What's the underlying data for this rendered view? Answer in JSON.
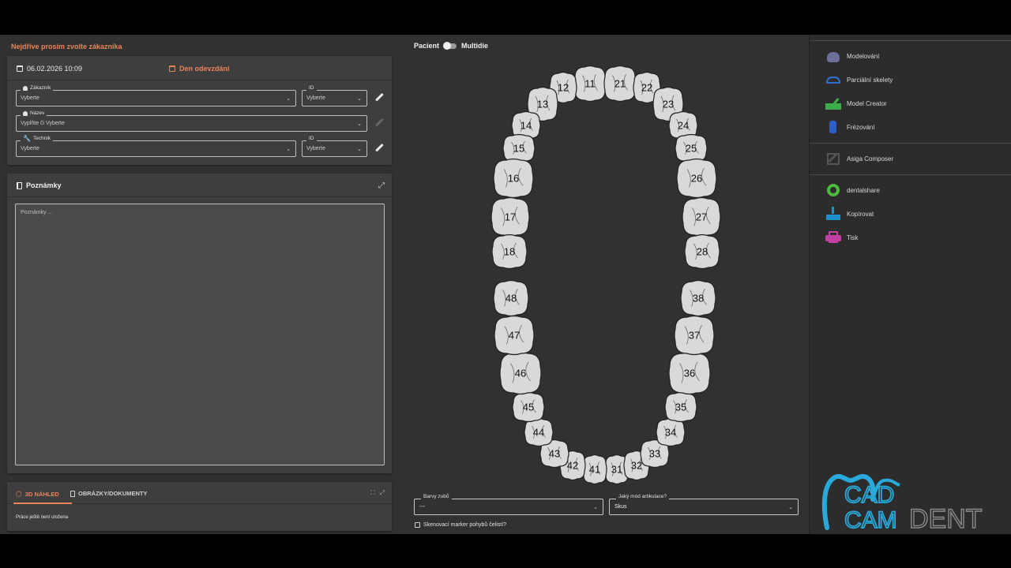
{
  "left": {
    "warning": "Nejdříve prosím zvolte zákazníka",
    "order": {
      "date": "06.02.2026 10:09",
      "deadline": "Den odevzdání",
      "customer": {
        "label": "Zákazník",
        "value": "Vyberte"
      },
      "customer_id": {
        "label": "ID",
        "value": "Vyberte"
      },
      "name": {
        "label": "Název",
        "value": "Vyplňte či Vyberte"
      },
      "technician": {
        "label": "Technik",
        "value": "Vyberte"
      },
      "technician_id": {
        "label": "ID",
        "value": "Vyberte"
      }
    },
    "notes": {
      "title": "Poznámky",
      "placeholder": "Poznámky ..."
    },
    "preview": {
      "tab_3d": "3D NÁHLED",
      "tab_docs": "OBRÁZKY/DOKUMENTY",
      "status": "Práce ještě není uložena"
    }
  },
  "center": {
    "toggle_left": "Pacient",
    "toggle_right": "Multidie",
    "teeth": [
      "11",
      "12",
      "13",
      "14",
      "15",
      "16",
      "17",
      "18",
      "21",
      "22",
      "23",
      "24",
      "25",
      "26",
      "27",
      "28",
      "31",
      "32",
      "33",
      "34",
      "35",
      "36",
      "37",
      "38",
      "41",
      "42",
      "43",
      "44",
      "45",
      "46",
      "47",
      "48"
    ],
    "tooth_colors": {
      "label": "Barvy zubů",
      "value": "---"
    },
    "articulation": {
      "label": "Jaký mód artikulace?",
      "value": "Skus"
    },
    "scan_marker": "Skenovací marker pohybů čelistí?"
  },
  "right": {
    "menu": [
      {
        "label": "Modelování",
        "icon": "modeling-icon",
        "color": "#6d6f99"
      },
      {
        "label": "Parciální skelety",
        "icon": "partial-frameworks-icon",
        "color": "#2f6fd0"
      },
      {
        "label": "Model Creator",
        "icon": "model-creator-icon",
        "color": "#3cae4a"
      },
      {
        "label": "Frézování",
        "icon": "milling-icon",
        "color": "#2d5fc9"
      },
      {
        "label": "Asiga Composer",
        "icon": "asiga-composer-icon",
        "color": "#555555"
      },
      {
        "label": "dentalshare",
        "icon": "dentalshare-icon",
        "color": "#4cba3c"
      },
      {
        "label": "Kopírovat",
        "icon": "copy-icon",
        "color": "#1f8fc9"
      },
      {
        "label": "Tisk",
        "icon": "print-icon",
        "color": "#c23fa6"
      }
    ],
    "logo": {
      "cad": "CAD",
      "cam": "CAM",
      "dent": "DENT"
    }
  },
  "colors": {
    "accent": "#e8845a",
    "panel": "#3e3e3e",
    "background": "#313131",
    "logo_blue": "#29a9d9"
  }
}
